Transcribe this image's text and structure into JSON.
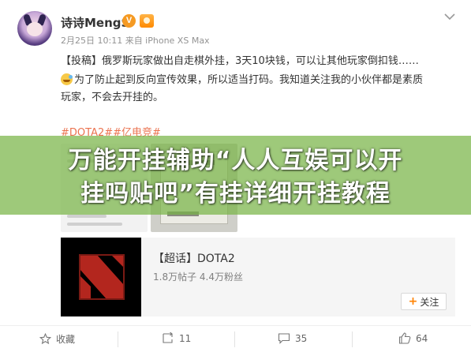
{
  "post": {
    "username": "诗诗MengS",
    "vip_badge": "V",
    "meta": "2月25日 10:11 来自 iPhone XS Max",
    "line1": "【投稿】俄罗斯玩家做出自走棋外挂，3天10块钱，可以让其他玩家倒扣钱……",
    "line2": "为了防止起到反向宣传效果，所以适当打码。我知道关注我的小伙伴都是素质",
    "line3": "玩家，不会去开挂的。",
    "hashtags": "#DOTA2##亿电竞#"
  },
  "banner": {
    "title_line1": "万能开挂辅助“人人互娱可以开",
    "title_line2": "挂吗贴吧”有挂详细开挂教程"
  },
  "card": {
    "title": "【超话】DOTA2",
    "sub": "1.8万帖子 4.4万粉丝",
    "follow_label": "关注"
  },
  "actions": {
    "favorite_label": "收藏",
    "repost_count": "11",
    "comment_count": "35",
    "like_count": "64"
  },
  "icons": [
    "chevron-down-icon",
    "star-icon",
    "repost-icon",
    "comment-icon",
    "like-icon",
    "plus-icon"
  ],
  "colors": {
    "accent_orange": "#ff8200",
    "hashtag": "#eb7350",
    "banner_green": "#78b446"
  }
}
